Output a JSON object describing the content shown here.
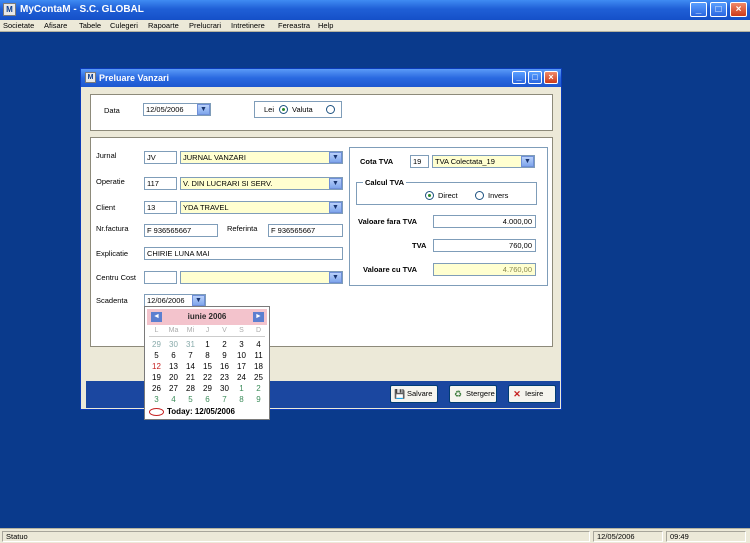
{
  "app": {
    "title": "MyContaM - S.C. GLOBAL"
  },
  "menu": [
    "Societate",
    "Afisare",
    "Tabele",
    "Culegeri",
    "Rapoarte",
    "Prelucrari",
    "Intretinere",
    "Fereastra",
    "Help"
  ],
  "status": {
    "text": "Statuo",
    "date": "12/05/2006",
    "time": "09:49"
  },
  "dialog": {
    "title": "Preluare Vanzari",
    "data_label": "Data",
    "data_value": "12/05/2006",
    "lei_label": "Lei",
    "valuta_label": "Valuta",
    "jurnal": {
      "label": "Jurnal",
      "code": "JV",
      "name": "JURNAL VANZARI"
    },
    "operatie": {
      "label": "Operatie",
      "code": "117",
      "name": "V. DIN LUCRARI SI SERV."
    },
    "client": {
      "label": "Client",
      "code": "13",
      "name": "YDA TRAVEL"
    },
    "nr_factura": {
      "label": "Nr.factura",
      "value": "F 936565667"
    },
    "referinta": {
      "label": "Referinta",
      "value": "F 936565667"
    },
    "explicatie": {
      "label": "Explicatie",
      "value": "CHIRIE LUNA MAI"
    },
    "centru_cost": {
      "label": "Centru Cost"
    },
    "scadenta": {
      "label": "Scadenta",
      "value": "12/06/2006"
    },
    "cota_tva": {
      "label": "Cota TVA",
      "code": "19",
      "name": "TVA Colectata_19"
    },
    "calcul_tva": {
      "label": "Calcul TVA",
      "direct": "Direct",
      "invers": "Invers"
    },
    "valoare_fara_tva": {
      "label": "Valoare fara TVA",
      "value": "4.000,00"
    },
    "tva": {
      "label": "TVA",
      "value": "760,00"
    },
    "valoare_cu_tva": {
      "label": "Valoare cu TVA",
      "value": "4.760,00"
    },
    "buttons": {
      "salvare": "Salvare",
      "stergere": "Stergere",
      "iesire": "Iesire"
    }
  },
  "calendar": {
    "title": "iunie 2006",
    "weekdays": [
      "L",
      "Ma",
      "Mi",
      "J",
      "V",
      "S",
      "D"
    ],
    "weeks": [
      [
        "29",
        "30",
        "31",
        "1",
        "2",
        "3",
        "4"
      ],
      [
        "5",
        "6",
        "7",
        "8",
        "9",
        "10",
        "11"
      ],
      [
        "12",
        "13",
        "14",
        "15",
        "16",
        "17",
        "18"
      ],
      [
        "19",
        "20",
        "21",
        "22",
        "23",
        "24",
        "25"
      ],
      [
        "26",
        "27",
        "28",
        "29",
        "30",
        "1",
        "2"
      ],
      [
        "3",
        "4",
        "5",
        "6",
        "7",
        "8",
        "9"
      ]
    ],
    "today_label": "Today: 12/05/2006"
  },
  "colors": {
    "desktop": "#0a3a8c",
    "titlebar": "#1f5fd6",
    "highlight": "#ffffd0",
    "calendar_header": "#f3c3cc"
  }
}
